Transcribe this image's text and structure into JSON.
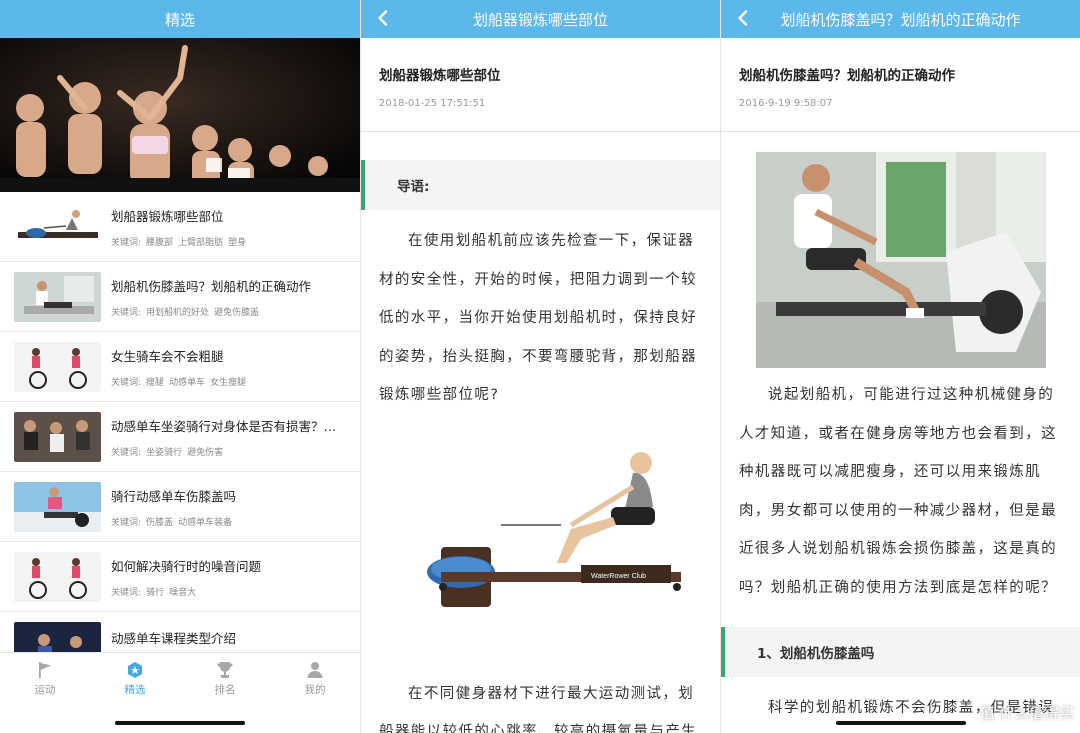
{
  "panel1": {
    "nav_title": "精选",
    "items": [
      {
        "title": "划船器锻炼哪些部位",
        "kw_label": "关键词:",
        "keywords": [
          "腰腹部",
          "上臂部脂肪",
          "塑身"
        ]
      },
      {
        "title": "划船机伤膝盖吗？划船机的正确动作",
        "kw_label": "关键词:",
        "keywords": [
          "用划船机的好处",
          "避免伤膝盖"
        ]
      },
      {
        "title": "女生骑车会不会粗腿",
        "kw_label": "关键词:",
        "keywords": [
          "瘦腿",
          "动感单车",
          "女生瘦腿"
        ]
      },
      {
        "title": "动感单车坐姿骑行对身体是否有损害？…",
        "kw_label": "关键词:",
        "keywords": [
          "坐姿骑行",
          "避免伤害"
        ]
      },
      {
        "title": "骑行动感单车伤膝盖吗",
        "kw_label": "关键词:",
        "keywords": [
          "伤膝盖",
          "动感单车装备"
        ]
      },
      {
        "title": "如何解决骑行时的噪音问题",
        "kw_label": "关键词:",
        "keywords": [
          "骑行",
          "噪音大"
        ]
      },
      {
        "title": "动感单车课程类型介绍",
        "kw_label": "",
        "keywords": []
      }
    ],
    "tabs": [
      {
        "label": "运动",
        "icon": "flag-icon"
      },
      {
        "label": "精选",
        "icon": "hexagon-icon"
      },
      {
        "label": "排名",
        "icon": "trophy-icon"
      },
      {
        "label": "我的",
        "icon": "person-icon"
      }
    ],
    "active_tab": 1
  },
  "panel2": {
    "nav_title": "划船器锻炼哪些部位",
    "title": "划船器锻炼哪些部位",
    "date": "2018-01-25 17:51:51",
    "section": "导语:",
    "para1": "在使用划船机前应该先检查一下，保证器材的安全性，开始的时候，把阻力调到一个较低的水平，当你开始使用划船机时，保持良好的姿势，抬头挺胸，不要弯腰驼背，那划船器锻炼哪些部位呢?",
    "image_caption": "WaterRower Club",
    "para2": "在不同健身器材下进行最大运动测试，划船器能以较低的心跳率、较高的摄氧量与产生"
  },
  "panel3": {
    "nav_title": "划船机伤膝盖吗？划船机的正确动作",
    "title": "划船机伤膝盖吗？划船机的正确动作",
    "date": "2016-9-19 9:58:07",
    "para1": "说起划船机，可能进行过这种机械健身的人才知道，或者在健身房等地方也会看到，这种机器既可以减肥瘦身，还可以用来锻炼肌肉，男女都可以使用的一种减少器材，但是最近很多人说划船机锻炼会损伤膝盖，这是真的吗？划船机正确的使用方法到底是怎样的呢？",
    "section": "1、划船机伤膝盖吗",
    "para2": "科学的划船机锻炼不会伤膝盖，但是错误"
  },
  "watermark": "值 什么值得买",
  "colors": {
    "nav": "#5cb7ea",
    "accent": "#41a9e3",
    "section_bar": "#3aa672"
  }
}
